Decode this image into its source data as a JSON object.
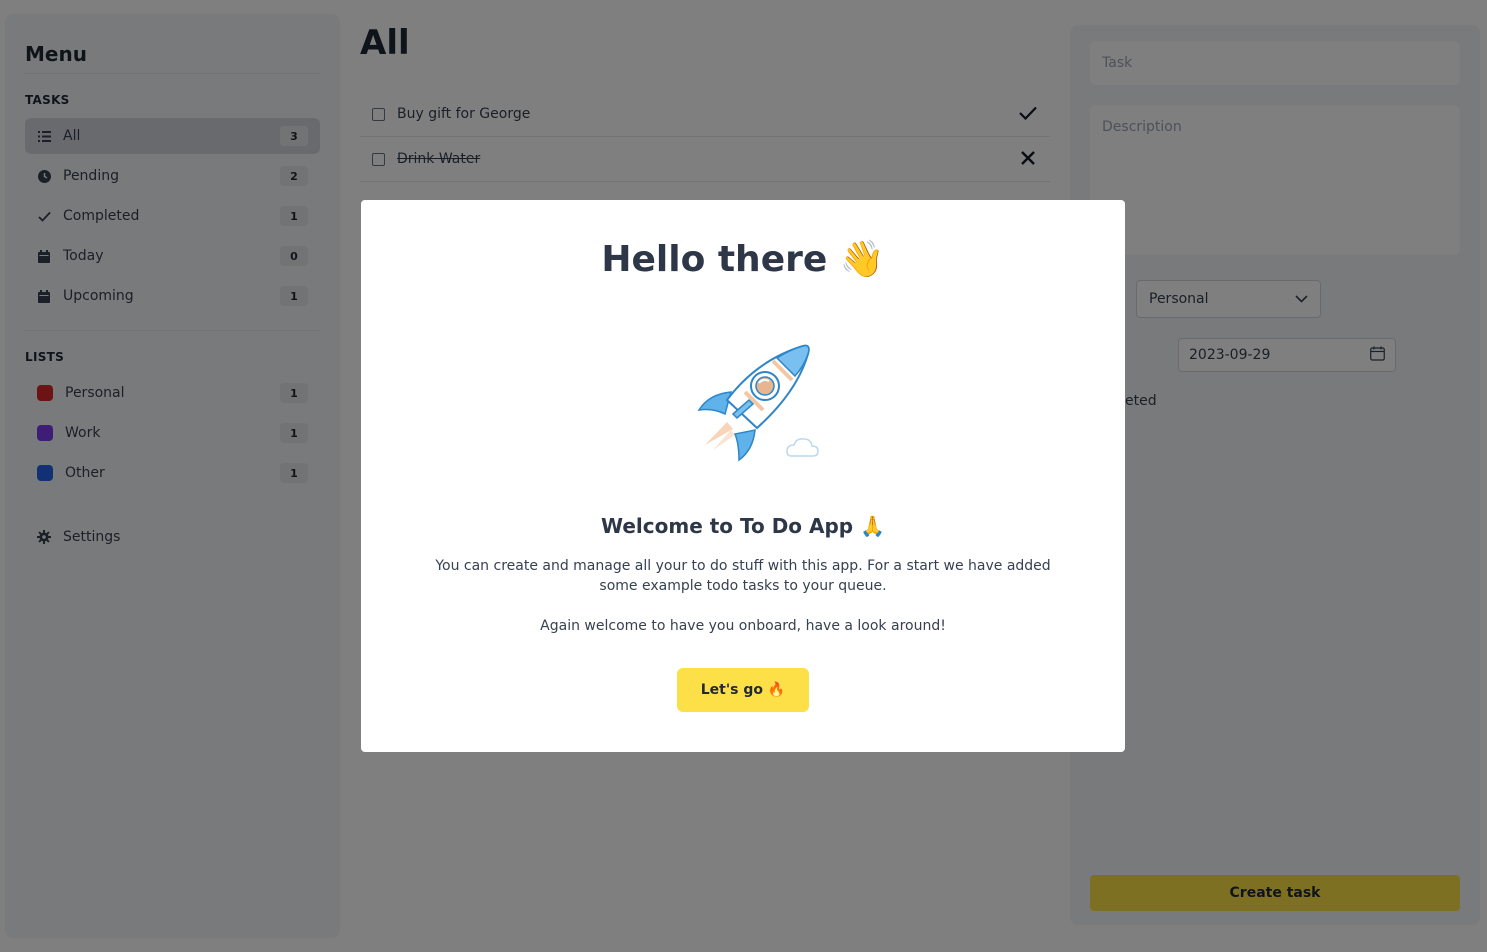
{
  "sidebar": {
    "title": "Menu",
    "tasks_heading": "TASKS",
    "tasks": [
      {
        "label": "All",
        "count": "3",
        "icon": "list-icon"
      },
      {
        "label": "Pending",
        "count": "2",
        "icon": "clock-icon"
      },
      {
        "label": "Completed",
        "count": "1",
        "icon": "check-icon"
      },
      {
        "label": "Today",
        "count": "0",
        "icon": "calendar-icon"
      },
      {
        "label": "Upcoming",
        "count": "1",
        "icon": "calendar-icon"
      }
    ],
    "lists_heading": "LISTS",
    "lists": [
      {
        "label": "Personal",
        "count": "1",
        "color": "#dc2626"
      },
      {
        "label": "Work",
        "count": "1",
        "color": "#7c3aed"
      },
      {
        "label": "Other",
        "count": "1",
        "color": "#2563eb"
      }
    ],
    "settings_label": "Settings"
  },
  "main": {
    "title": "All",
    "tasks": [
      {
        "label": "Buy gift for George",
        "done": false
      },
      {
        "label": "Drink Water",
        "done": true
      }
    ]
  },
  "form": {
    "task_placeholder": "Task",
    "description_placeholder": "Description",
    "list_selected": "Personal",
    "date_label": "date",
    "date_value": "2023-09-29",
    "completed_label": "ompleted",
    "create_label": "Create task"
  },
  "modal": {
    "title": "Hello there 👋",
    "subtitle": "Welcome to To Do App 🙏",
    "body1": "You can create and manage all your to do stuff with this app. For a start we have added some example todo tasks to your queue.",
    "body2": "Again welcome to have you onboard, have a look around!",
    "button": "Let's go 🔥"
  },
  "colors": {
    "accent": "#fde047",
    "overlay": "rgba(0,0,0,0.5)"
  }
}
